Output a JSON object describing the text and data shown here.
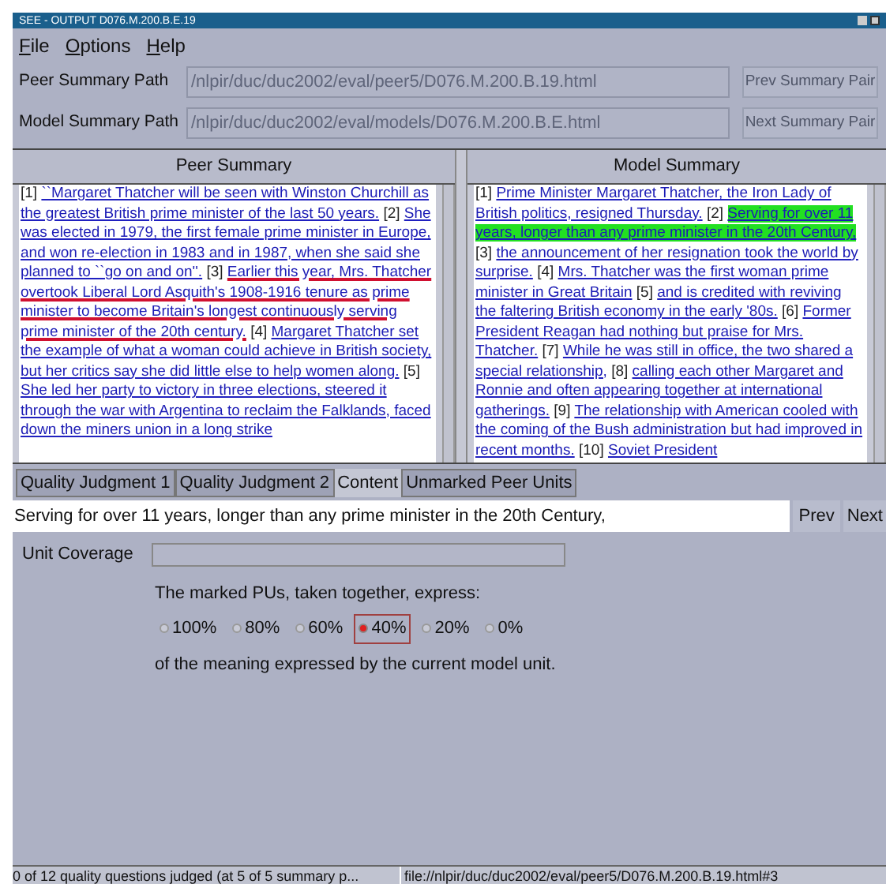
{
  "window": {
    "title": "SEE - OUTPUT D076.M.200.B.E.19"
  },
  "menu": [
    "File",
    "Options",
    "Help"
  ],
  "paths": [
    {
      "label": "Peer Summary Path",
      "value": "/nlpir/duc/duc2002/eval/peer5/D076.M.200.B.19.html",
      "button": "Prev Summary Pair"
    },
    {
      "label": "Model Summary Path",
      "value": "/nlpir/duc/duc2002/eval/models/D076.M.200.B.E.html",
      "button": "Next Summary Pair"
    }
  ],
  "peer_summary": {
    "title": "Peer Summary",
    "units": [
      {
        "number": "[1]",
        "text": "``Margaret Thatcher will be seen with Winston Churchill as the greatest British prime minister of the last 50 years.",
        "marked": false
      },
      {
        "number": "[2]",
        "text": "She was elected in 1979, the first female prime minister in Europe, and won re-election in 1983 and in 1987, when she said she planned to ``go on and on''.",
        "marked": false
      },
      {
        "number": "[3]",
        "text": "Earlier this year, Mrs. Thatcher overtook Liberal Lord Asquith's 1908-1916 tenure as prime minister to become Britain's longest continuously serving prime minister of the 20th century.",
        "marked": true
      },
      {
        "number": "[4]",
        "text": "Margaret Thatcher set the example of what a woman could achieve in British society, but her critics say she did little else to help women along.",
        "marked": false
      },
      {
        "number": "[5]",
        "text": "She led her party to victory in three elections, steered it through the war with Argentina to reclaim the Falklands, faced down the miners union in a long strike",
        "marked": false
      }
    ]
  },
  "model_summary": {
    "title": "Model Summary",
    "units": [
      {
        "number": "[1]",
        "text": "Prime Minister Margaret Thatcher, the Iron Lady of British politics, resigned Thursday.",
        "selected": false
      },
      {
        "number": "[2]",
        "text": "Serving for over 11 years, longer than any prime minister in the 20th Century,",
        "selected": true
      },
      {
        "number": "[3]",
        "text": "the announcement of her resignation took the world by surprise.",
        "selected": false
      },
      {
        "number": "[4]",
        "text": "Mrs. Thatcher was the first woman prime minister in Great Britain",
        "selected": false
      },
      {
        "number": "[5]",
        "text": "and is credited with reviving the faltering British economy in the early '80s.",
        "selected": false
      },
      {
        "number": "[6]",
        "text": "Former President Reagan had nothing but praise for Mrs. Thatcher.",
        "selected": false
      },
      {
        "number": "[7]",
        "text": "While he was still in office, the two shared a special relationship,",
        "selected": false
      },
      {
        "number": "[8]",
        "text": "calling each other Margaret and Ronnie and often appearing together at international gatherings.",
        "selected": false
      },
      {
        "number": "[9]",
        "text": "The relationship with American cooled with the coming of the Bush administration but had improved in recent months.",
        "selected": false
      },
      {
        "number": "[10]",
        "text": "Soviet President",
        "selected": false
      }
    ]
  },
  "tabs": [
    {
      "label": "Quality Judgment 1",
      "selected": false
    },
    {
      "label": "Quality Judgment 2",
      "selected": false
    },
    {
      "label": "Content",
      "selected": true
    },
    {
      "label": "Unmarked Peer Units",
      "selected": false
    }
  ],
  "current_unit": {
    "value": "Serving for over 11 years, longer than any prime minister in the 20th Century,",
    "prev": "Prev",
    "next": "Next"
  },
  "unit_coverage": {
    "label": "Unit Coverage"
  },
  "question": {
    "lead": "The marked PUs, taken together, express:",
    "options": [
      {
        "label": "100%",
        "selected": false
      },
      {
        "label": "80%",
        "selected": false
      },
      {
        "label": "60%",
        "selected": false
      },
      {
        "label": "40%",
        "selected": true
      },
      {
        "label": "20%",
        "selected": false
      },
      {
        "label": "0%",
        "selected": false
      }
    ],
    "tail": "of the meaning expressed by the current model unit."
  },
  "status_bar": [
    "0 of 12 quality questions judged (at 5 of 5 summary p...",
    "file://nlpir/duc/duc2002/eval/peer5/D076.M.200.B.19.html#3"
  ]
}
